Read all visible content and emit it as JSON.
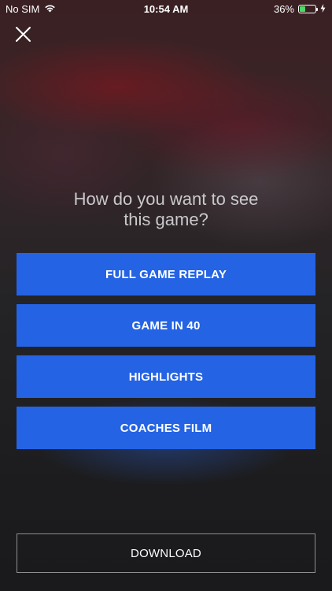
{
  "status_bar": {
    "carrier": "No SIM",
    "time": "10:54 AM",
    "battery_percent": "36%",
    "battery_level": 0.36,
    "battery_color": "#4cd964",
    "icons": [
      "wifi-icon",
      "battery-icon",
      "charging-bolt-icon"
    ]
  },
  "close_icon": "close-icon",
  "prompt": {
    "line1": "How do you want to see",
    "line2": "this game?"
  },
  "options": [
    {
      "label": "FULL GAME REPLAY"
    },
    {
      "label": "GAME IN 40"
    },
    {
      "label": "HIGHLIGHTS"
    },
    {
      "label": "COACHES FILM"
    }
  ],
  "download": {
    "label": "DOWNLOAD"
  },
  "colors": {
    "accent": "#2463e4",
    "background": "#1b1b1d",
    "prompt_text": "#c9c9cc",
    "download_border": "#8e8e92"
  }
}
